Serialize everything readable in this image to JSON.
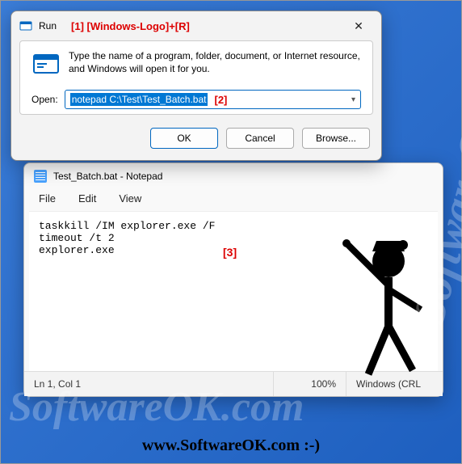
{
  "run": {
    "title": "Run",
    "annotation1": "[1] [Windows-Logo]+[R]",
    "description": "Type the name of a program, folder, document, or Internet resource, and Windows will open it for you.",
    "open_label": "Open:",
    "input_value": "notepad C:\\Test\\Test_Batch.bat",
    "annotation2": "[2]",
    "buttons": {
      "ok": "OK",
      "cancel": "Cancel",
      "browse": "Browse..."
    }
  },
  "notepad": {
    "title": "Test_Batch.bat - Notepad",
    "menu": {
      "file": "File",
      "edit": "Edit",
      "view": "View"
    },
    "content": "taskkill /IM explorer.exe /F\ntimeout /t 2\nexplorer.exe",
    "annotation3": "[3]",
    "status": {
      "pos": "Ln 1, Col 1",
      "zoom": "100%",
      "encoding": "Windows (CRL"
    }
  },
  "watermark": "SoftwareOK.com",
  "footer": "www.SoftwareOK.com :-)"
}
